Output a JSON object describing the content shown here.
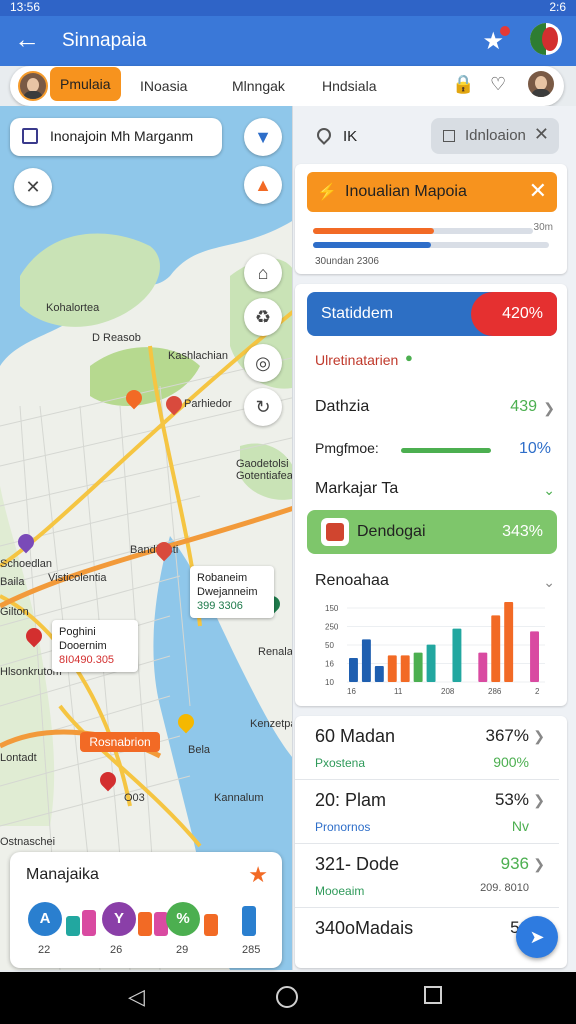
{
  "status": {
    "time": "13:56",
    "right": "2:6"
  },
  "appbar": {
    "title": "Sinnapaia",
    "back_icon": "arrow-left-icon",
    "star_icon": "star-icon"
  },
  "tabs": [
    {
      "label": "Pmulaia"
    },
    {
      "label": "INoasia"
    },
    {
      "label": "Mlnngak"
    },
    {
      "label": "Hndsiala"
    }
  ],
  "map": {
    "search_label": "Inonajoin Mh Marganm",
    "labels": {
      "kohlanta": "Kohalortea",
      "rd": "D Reasob",
      "kansche": "Kashlachian",
      "parahedor": "Parhiedor",
      "gaodetolsi": "Gaodetolsi Gotentiafeae",
      "bandfuisti": "Bandfuisti",
      "schoedlan": "Schoedlan",
      "vsticolentia": "Visticolentia",
      "bala": "Baila",
      "gilton": "Gilton",
      "ranala": "Renala",
      "hlsonkrutom": "Hlsonkrutom",
      "kenzetpa": "Kenzetpa",
      "bela": "Bela",
      "lontadt": "Lontadt",
      "bo": "O03",
      "karrelem": "Kannalum",
      "ostnaschei": "Ostnaschei"
    },
    "callout1": {
      "line1": "Robaneim",
      "line2": "Dwejanneim",
      "line3": "399 3306"
    },
    "callout2": {
      "line1": "Poghini",
      "line2": "Dooernim",
      "line3": "8I0490.305"
    },
    "orange_tag": "Rosnabrion"
  },
  "mapcard": {
    "title": "Manajaika",
    "labels": [
      "22",
      "26",
      "29",
      "285"
    ]
  },
  "panel": {
    "location": "IK",
    "chip": "Idnloaion",
    "info_card": {
      "title": "Inoualian Mapoia",
      "small_right": "30m",
      "caption": "30undan 2306"
    },
    "stats_card": {
      "header_title": "Statiddem",
      "header_pct": "420%",
      "subtitle": "Ulretinatarien",
      "rows": [
        {
          "label": "Dathzia",
          "value": "439"
        },
        {
          "label": "Pmgfmoe:",
          "value": "10%"
        },
        {
          "label": "Markajar Ta",
          "value": ""
        }
      ],
      "green_bar": {
        "label": "Dendogai",
        "value": "343%"
      },
      "chart_title": "Renoahaa"
    },
    "list": [
      {
        "title": "60 Madan",
        "sub": "Pxostena",
        "value": "367%",
        "value2": "900%"
      },
      {
        "title": "20: Plam",
        "sub": "Pronornos",
        "value": "53%",
        "value2": "Nv"
      },
      {
        "title": "321- Dode",
        "sub": "Mooeaim",
        "value": "936",
        "value2": "209. 8010"
      },
      {
        "title": "340oMadais",
        "sub": "",
        "value": "56",
        "value2": ""
      }
    ]
  },
  "colors": {
    "orange": "#f7931e",
    "blue": "#3a78d8",
    "red": "#e53030",
    "green": "#7ec66b"
  },
  "chart_data": {
    "type": "bar",
    "title": "Renoahaa",
    "ylabel": "",
    "xlabel": "",
    "yticks": [
      "150",
      "250",
      "50",
      "16",
      "10"
    ],
    "xticks": [
      "16",
      "11",
      "208",
      "286",
      "2"
    ],
    "series": [
      {
        "name": "",
        "color": "#1f5fb0",
        "values": [
          18,
          32,
          12,
          0,
          0,
          0,
          0,
          0,
          0,
          0,
          0,
          0,
          0,
          0,
          0
        ]
      },
      {
        "name": "",
        "color": "#f26a25",
        "values": [
          0,
          0,
          0,
          20,
          20,
          0,
          0,
          0,
          0,
          0,
          0,
          50,
          60,
          0,
          0
        ]
      },
      {
        "name": "",
        "color": "#4caf50",
        "values": [
          0,
          0,
          0,
          0,
          0,
          22,
          0,
          0,
          0,
          0,
          0,
          0,
          0,
          0,
          0
        ]
      },
      {
        "name": "",
        "color": "#22a7a0",
        "values": [
          0,
          0,
          0,
          0,
          0,
          0,
          28,
          0,
          40,
          0,
          0,
          0,
          0,
          0,
          0
        ]
      },
      {
        "name": "",
        "color": "#5cb8e0",
        "values": [
          0,
          0,
          0,
          0,
          0,
          0,
          0,
          0,
          0,
          0,
          0,
          0,
          0,
          0,
          0
        ]
      },
      {
        "name": "",
        "color": "#d94aa1",
        "values": [
          0,
          0,
          0,
          0,
          0,
          0,
          0,
          0,
          0,
          0,
          22,
          0,
          0,
          0,
          38
        ]
      }
    ],
    "categories": [
      "1",
      "2",
      "3",
      "4",
      "5",
      "6",
      "7",
      "8",
      "9",
      "10",
      "11",
      "12",
      "13",
      "14",
      "15"
    ]
  }
}
